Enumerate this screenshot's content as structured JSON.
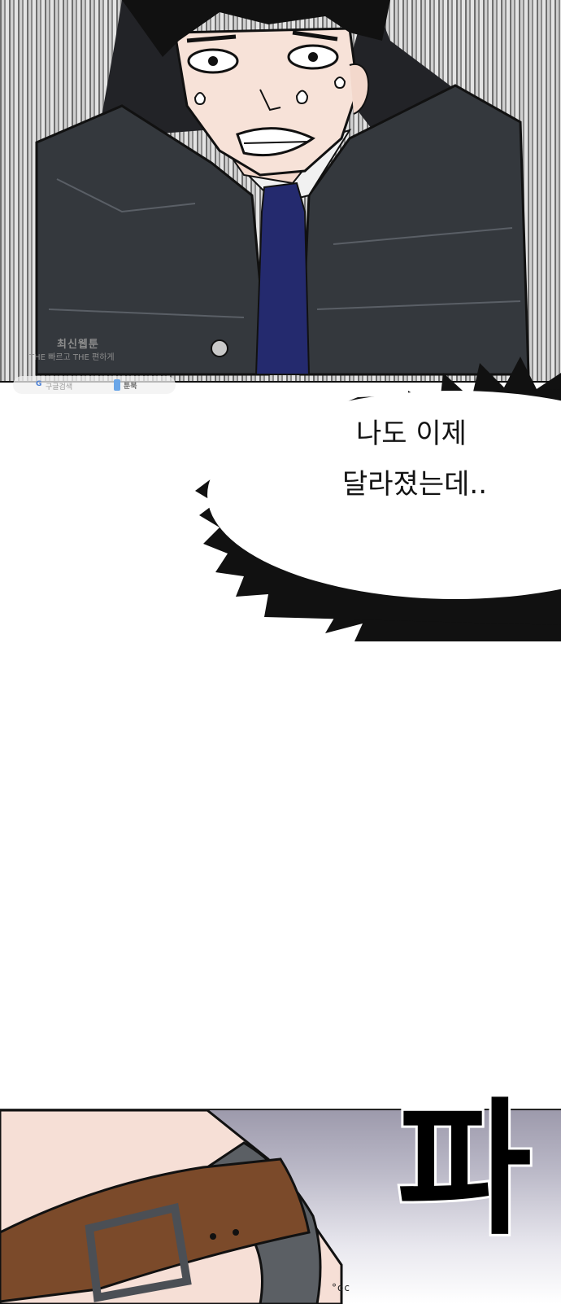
{
  "watermark": {
    "line1": "최신웹툰",
    "line2": "THE 빠르고 THE 편하게",
    "search_label": "구글검색",
    "brand": "툰북"
  },
  "speech_bubble": {
    "line1": "나도 이제",
    "line2": "달라졌는데.."
  },
  "sound_effect": {
    "text": "파",
    "trail": "°oc"
  },
  "colors": {
    "tie": "#242a6e",
    "jacket": "#34383d",
    "strap": "#7b4a2a",
    "bubble_spikes": "#111111"
  }
}
